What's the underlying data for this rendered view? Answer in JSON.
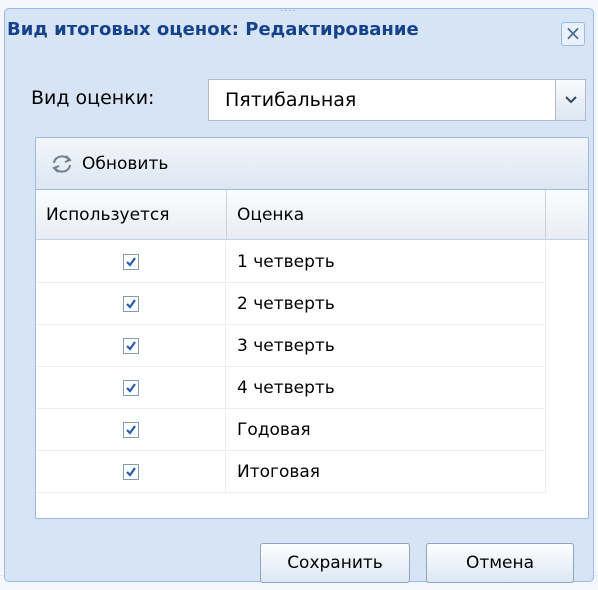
{
  "dialog": {
    "title": "Вид итоговых оценок: Редактирование",
    "close_glyph": "×"
  },
  "form": {
    "grade_type_label": "Вид оценки:",
    "grade_type_value": "Пятибальная"
  },
  "toolbar": {
    "refresh_label": "Обновить",
    "refresh_icon": "refresh-icon"
  },
  "grid": {
    "columns": [
      "Используется",
      "Оценка"
    ],
    "rows": [
      {
        "used": true,
        "grade": "1 четверть"
      },
      {
        "used": true,
        "grade": "2 четверть"
      },
      {
        "used": true,
        "grade": "3 четверть"
      },
      {
        "used": true,
        "grade": "4 четверть"
      },
      {
        "used": true,
        "grade": "Годовая"
      },
      {
        "used": true,
        "grade": "Итоговая"
      }
    ]
  },
  "buttons": {
    "save_label": "Сохранить",
    "cancel_label": "Отмена"
  },
  "colors": {
    "title_text": "#15428b",
    "window_frame": "#d6e4f5",
    "border": "#99bbe8",
    "check_mark": "#2a5db0"
  }
}
